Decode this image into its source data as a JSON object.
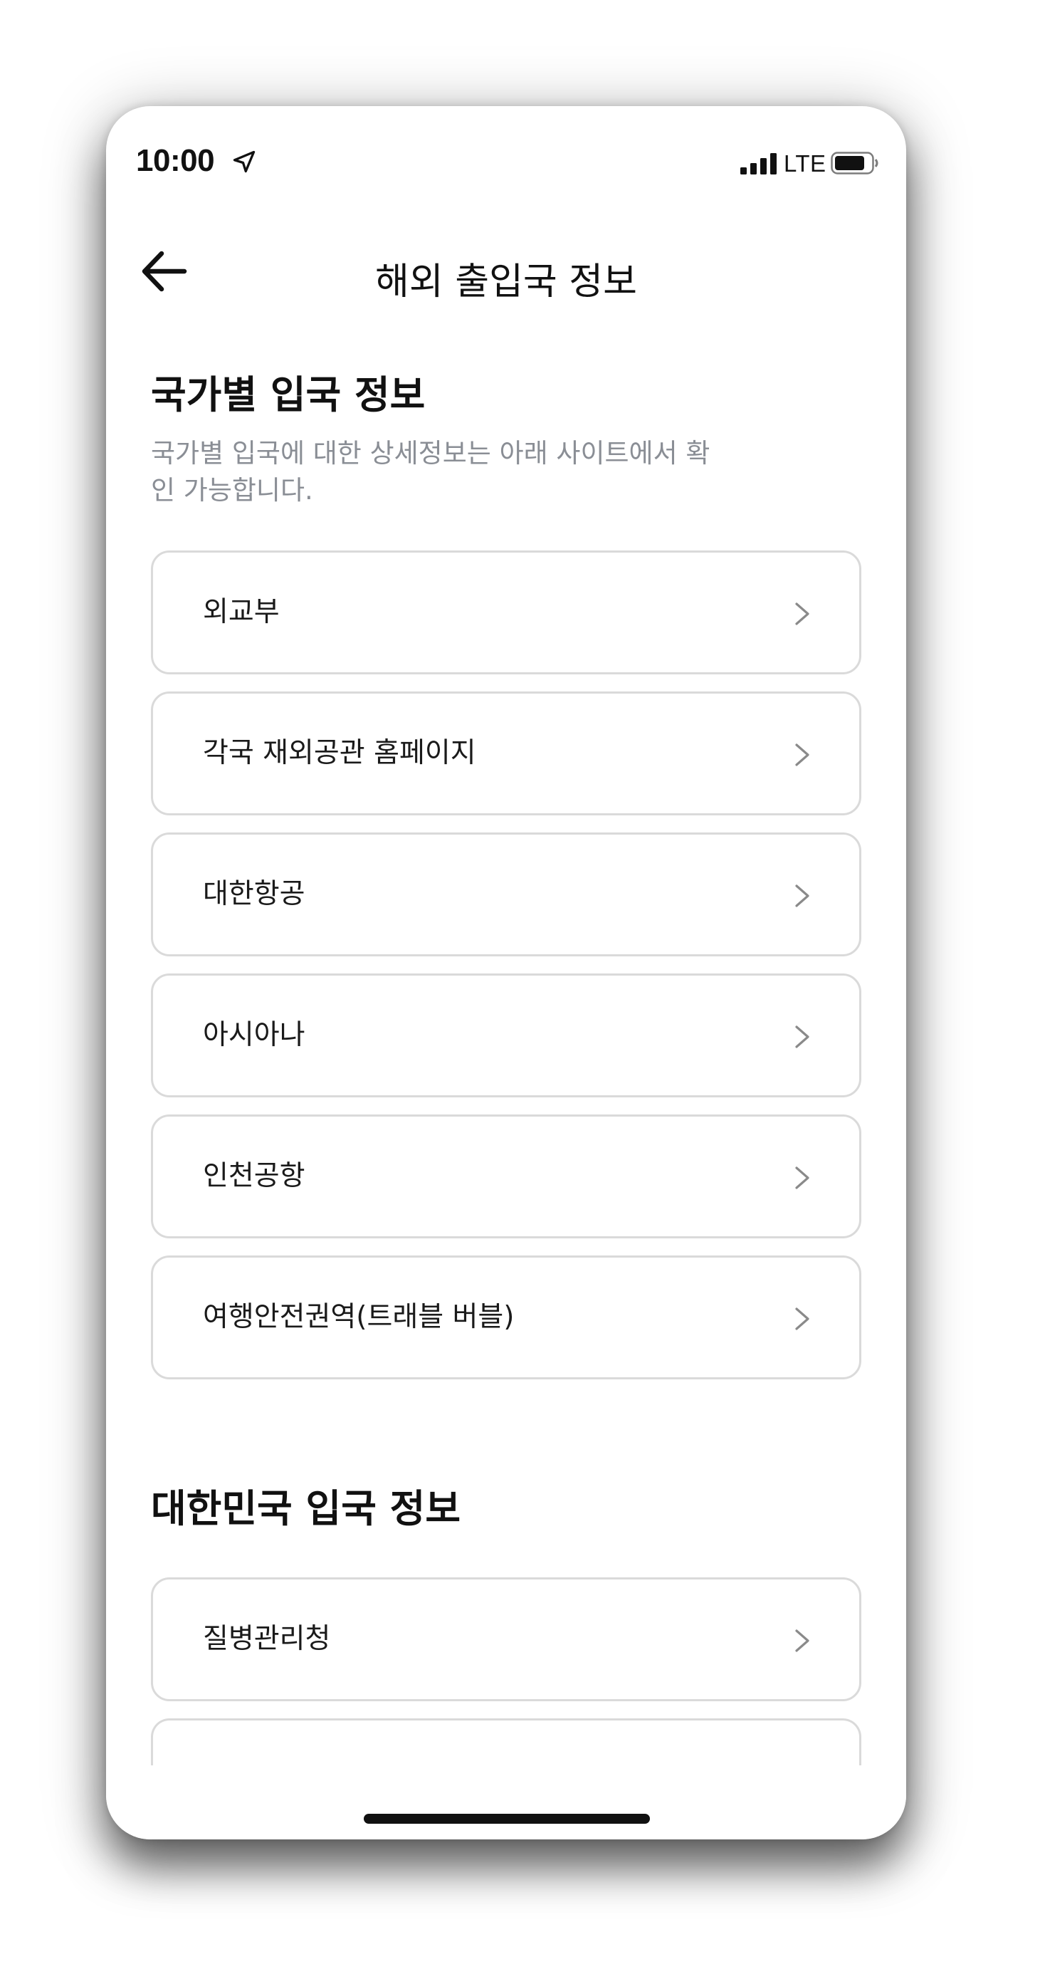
{
  "status_bar": {
    "time": "10:00",
    "network": "LTE"
  },
  "header": {
    "title": "해외 출입국 정보",
    "back_icon": "arrow-left-icon"
  },
  "section_country": {
    "title": "국가별 입국 정보",
    "description": "국가별 입국에 대한 상세정보는 아래 사이트에서 확인 가능합니다.",
    "links": [
      {
        "label": "외교부"
      },
      {
        "label": "각국 재외공관 홈페이지"
      },
      {
        "label": "대한항공"
      },
      {
        "label": "아시아나"
      },
      {
        "label": "인천공항"
      },
      {
        "label": "여행안전권역(트래블 버블)"
      }
    ]
  },
  "section_korea": {
    "title": "대한민국 입국 정보",
    "links": [
      {
        "label": "질병관리청"
      }
    ]
  },
  "colors": {
    "text_primary": "#111111",
    "text_secondary": "#8a8e95",
    "card_border": "#dadada",
    "background": "#ffffff"
  }
}
